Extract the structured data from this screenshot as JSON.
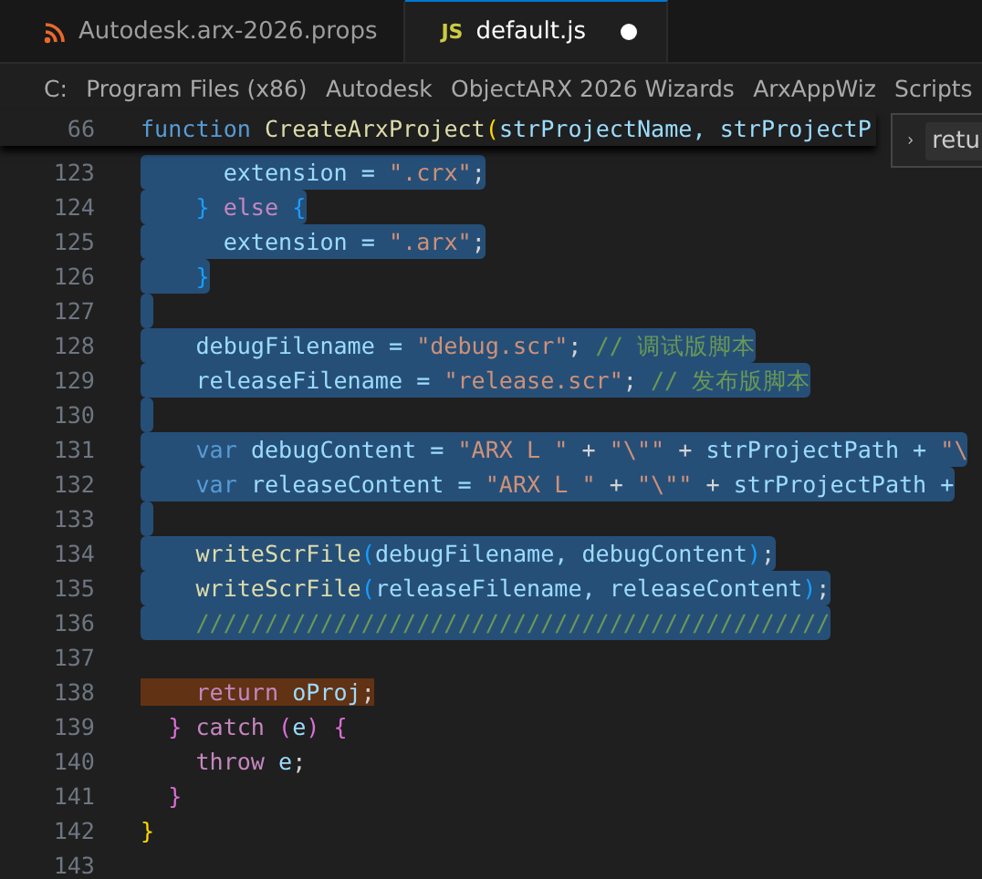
{
  "tabs": [
    {
      "kind": "props",
      "label": "Autodesk.arx-2026.props",
      "selected": false,
      "modified": false
    },
    {
      "kind": "script",
      "icon_text": "JS",
      "label": "default.js",
      "selected": true,
      "modified": true
    }
  ],
  "breadcrumb": [
    "C:",
    "Program Files (x86)",
    "Autodesk",
    "ObjectARX 2026 Wizards",
    "ArxAppWiz",
    "Scripts"
  ],
  "sticky_line": {
    "number": "66",
    "tokens": [
      {
        "text": "function ",
        "kind": "keyword"
      },
      {
        "text": "CreateArxProject",
        "kind": "function"
      },
      {
        "text": "(",
        "kind": "bracket1"
      },
      {
        "text": "strProjectName, ",
        "kind": "variable"
      },
      {
        "text": "strProjectP",
        "kind": "variable"
      }
    ]
  },
  "find_widget": {
    "value": "retu"
  },
  "lines": [
    {
      "number": "123",
      "selected": true,
      "highlighted": false,
      "tokens": [
        {
          "text": "      extension = ",
          "kind": "variable"
        },
        {
          "text": "\".crx\"",
          "kind": "string"
        },
        {
          "text": ";",
          "kind": "punctuation"
        }
      ]
    },
    {
      "number": "124",
      "selected": true,
      "highlighted": false,
      "tokens": [
        {
          "text": "    } ",
          "kind": "bracket3"
        },
        {
          "text": "else ",
          "kind": "control"
        },
        {
          "text": "{",
          "kind": "bracket3"
        }
      ]
    },
    {
      "number": "125",
      "selected": true,
      "highlighted": false,
      "tokens": [
        {
          "text": "      extension = ",
          "kind": "variable"
        },
        {
          "text": "\".arx\"",
          "kind": "string"
        },
        {
          "text": ";",
          "kind": "punctuation"
        }
      ]
    },
    {
      "number": "126",
      "selected": true,
      "highlighted": false,
      "tokens": [
        {
          "text": "    }",
          "kind": "bracket3"
        }
      ]
    },
    {
      "number": "127",
      "selected": true,
      "highlighted": false
    },
    {
      "number": "128",
      "selected": true,
      "highlighted": false,
      "tokens": [
        {
          "text": "    debugFilename = ",
          "kind": "variable"
        },
        {
          "text": "\"debug.scr\"",
          "kind": "string"
        },
        {
          "text": "; ",
          "kind": "punctuation"
        },
        {
          "text": "// 调试版脚本",
          "kind": "comment"
        }
      ]
    },
    {
      "number": "129",
      "selected": true,
      "highlighted": false,
      "tokens": [
        {
          "text": "    releaseFilename = ",
          "kind": "variable"
        },
        {
          "text": "\"release.scr\"",
          "kind": "string"
        },
        {
          "text": "; ",
          "kind": "punctuation"
        },
        {
          "text": "// 发布版脚本",
          "kind": "comment"
        }
      ]
    },
    {
      "number": "130",
      "selected": true,
      "highlighted": false
    },
    {
      "number": "131",
      "selected": true,
      "highlighted": false,
      "tokens": [
        {
          "text": "    var ",
          "kind": "keyword"
        },
        {
          "text": "debugContent = ",
          "kind": "variable"
        },
        {
          "text": "\"ARX L \"",
          "kind": "string"
        },
        {
          "text": " + ",
          "kind": "punctuation"
        },
        {
          "text": "\"\\\"\"",
          "kind": "string"
        },
        {
          "text": " + ",
          "kind": "punctuation"
        },
        {
          "text": "strProjectPath + ",
          "kind": "variable"
        },
        {
          "text": "\"\\",
          "kind": "string"
        }
      ]
    },
    {
      "number": "132",
      "selected": true,
      "highlighted": false,
      "tokens": [
        {
          "text": "    var ",
          "kind": "keyword"
        },
        {
          "text": "releaseContent = ",
          "kind": "variable"
        },
        {
          "text": "\"ARX L \"",
          "kind": "string"
        },
        {
          "text": " + ",
          "kind": "punctuation"
        },
        {
          "text": "\"\\\"\"",
          "kind": "string"
        },
        {
          "text": " + ",
          "kind": "punctuation"
        },
        {
          "text": "strProjectPath +",
          "kind": "variable"
        }
      ]
    },
    {
      "number": "133",
      "selected": true,
      "highlighted": false
    },
    {
      "number": "134",
      "selected": true,
      "highlighted": false,
      "tokens": [
        {
          "text": "    writeScrFile",
          "kind": "function"
        },
        {
          "text": "(",
          "kind": "bracket3"
        },
        {
          "text": "debugFilename, debugContent",
          "kind": "variable"
        },
        {
          "text": ")",
          "kind": "bracket3"
        },
        {
          "text": ";",
          "kind": "punctuation"
        }
      ]
    },
    {
      "number": "135",
      "selected": true,
      "highlighted": false,
      "tokens": [
        {
          "text": "    writeScrFile",
          "kind": "function"
        },
        {
          "text": "(",
          "kind": "bracket3"
        },
        {
          "text": "releaseFilename, releaseContent",
          "kind": "variable"
        },
        {
          "text": ")",
          "kind": "bracket3"
        },
        {
          "text": ";",
          "kind": "punctuation"
        }
      ]
    },
    {
      "number": "136",
      "selected": true,
      "highlighted": false,
      "tokens": [
        {
          "text": "    //////////////////////////////////////////////",
          "kind": "comment"
        }
      ]
    },
    {
      "number": "137",
      "selected": false,
      "highlighted": false
    },
    {
      "number": "138",
      "selected": false,
      "highlighted": true,
      "tokens": [
        {
          "text": "    return ",
          "kind": "control"
        },
        {
          "text": "oProj",
          "kind": "variable"
        },
        {
          "text": ";",
          "kind": "punctuation"
        }
      ]
    },
    {
      "number": "139",
      "selected": false,
      "highlighted": false,
      "tokens": [
        {
          "text": "  } ",
          "kind": "bracket2"
        },
        {
          "text": "catch ",
          "kind": "control"
        },
        {
          "text": "(",
          "kind": "bracket2"
        },
        {
          "text": "e",
          "kind": "variable"
        },
        {
          "text": ") {",
          "kind": "bracket2"
        }
      ]
    },
    {
      "number": "140",
      "selected": false,
      "highlighted": false,
      "tokens": [
        {
          "text": "    throw ",
          "kind": "control"
        },
        {
          "text": "e",
          "kind": "variable"
        },
        {
          "text": ";",
          "kind": "punctuation"
        }
      ]
    },
    {
      "number": "141",
      "selected": false,
      "highlighted": false,
      "tokens": [
        {
          "text": "  }",
          "kind": "bracket2"
        }
      ]
    },
    {
      "number": "142",
      "selected": false,
      "highlighted": false,
      "tokens": [
        {
          "text": "}",
          "kind": "bracket1"
        }
      ]
    },
    {
      "number": "143",
      "selected": false,
      "highlighted": false
    }
  ]
}
